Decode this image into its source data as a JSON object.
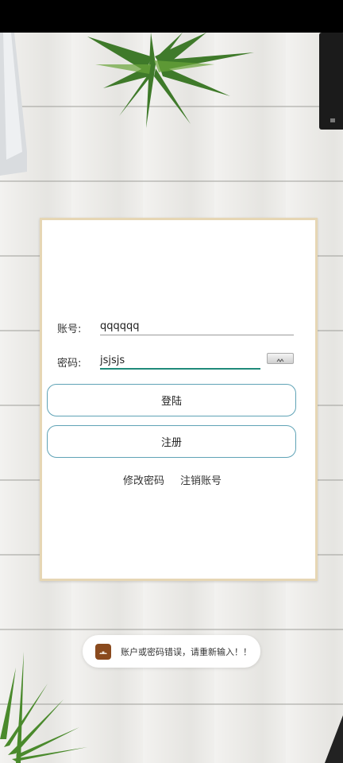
{
  "login": {
    "account_label": "账号:",
    "account_value": "qqqqqq",
    "password_label": "密码:",
    "password_value": "jsjsjs",
    "login_button": "登陆",
    "register_button": "注册",
    "change_password_link": "修改密码",
    "delete_account_link": "注销账号"
  },
  "toast": {
    "message": "账户或密码错误，请重新输入！！",
    "icon": "android-app-icon"
  },
  "colors": {
    "focus_underline": "#1f8a7a",
    "button_border": "#5fa3b6",
    "card_border": "#e6d6b4"
  }
}
